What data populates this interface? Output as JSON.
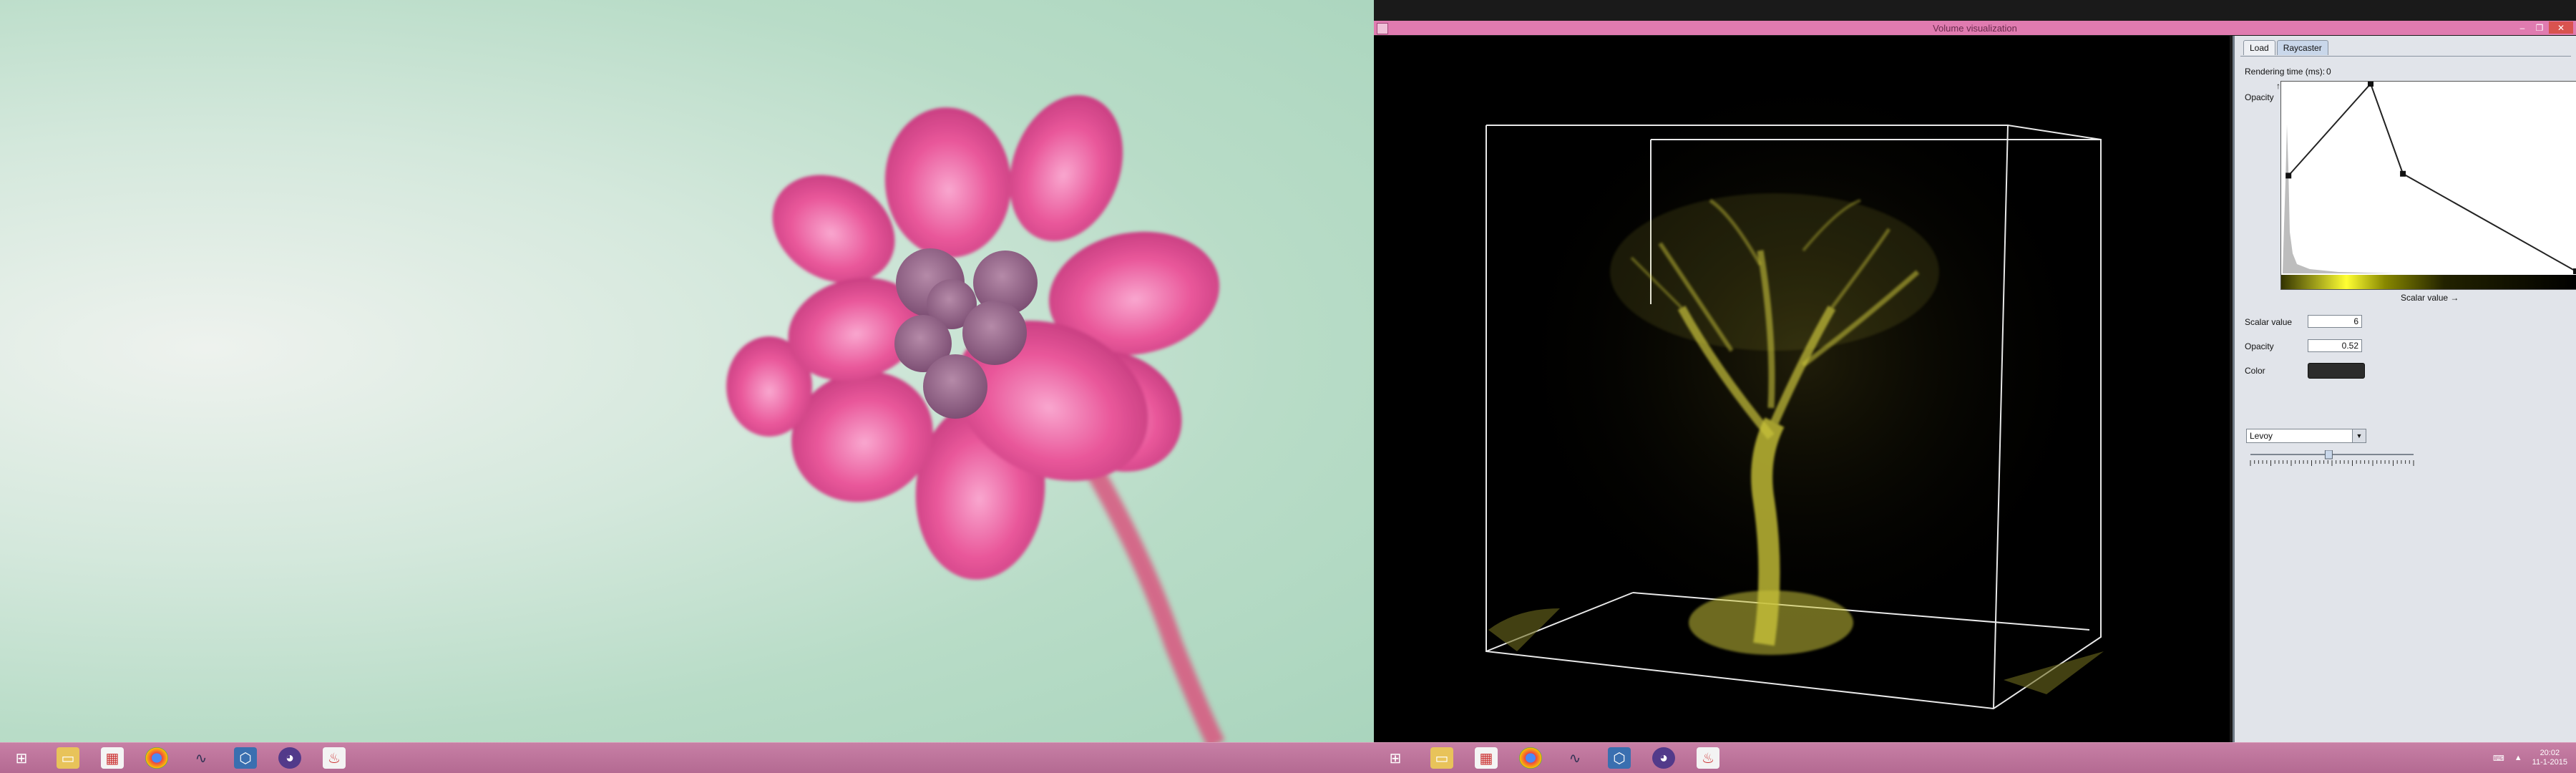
{
  "window": {
    "title": "Volume visualization",
    "controls": [
      "–",
      "❐",
      "✕"
    ]
  },
  "tabs": [
    {
      "label": "Load",
      "active": false
    },
    {
      "label": "Raycaster",
      "active": true
    }
  ],
  "panel": {
    "rendering_time_label": "Rendering time (ms):",
    "rendering_time_value": "0",
    "opacity_axis_label": "Opacity",
    "opacity_axis_arrow": "↑",
    "scalar_axis_label": "Scalar value →",
    "scalar_value_label": "Scalar value",
    "scalar_value": "6",
    "opacity_label": "Opacity",
    "opacity_value": "0.52",
    "color_label": "Color",
    "color_value": "#2c2c2c",
    "preset_selected": "Levoy",
    "slider_level": 0.48
  },
  "transfer_function": {
    "control_points": [
      {
        "scalar": 0.02,
        "opacity": 0.51
      },
      {
        "scalar": 0.3,
        "opacity": 1.0
      },
      {
        "scalar": 0.41,
        "opacity": 0.52
      },
      {
        "scalar": 1.0,
        "opacity": 0.0
      }
    ],
    "gradient_colors": [
      "#333300",
      "#ffff33",
      "#888800",
      "#222200",
      "#000000"
    ]
  },
  "taskbar": {
    "icons": [
      "windows-start-icon",
      "file-explorer-icon",
      "app-grid-icon",
      "chrome-icon",
      "graph-tool-icon",
      "virtualbox-icon",
      "cat-app-icon",
      "java-app-icon"
    ],
    "clock_time": "20:02",
    "clock_date": "11-1-2015",
    "tray_arrow": "▲"
  },
  "colors": {
    "accent": "#e07bb0",
    "taskbar": "#c77fa5",
    "volume": "#c8c23a"
  }
}
